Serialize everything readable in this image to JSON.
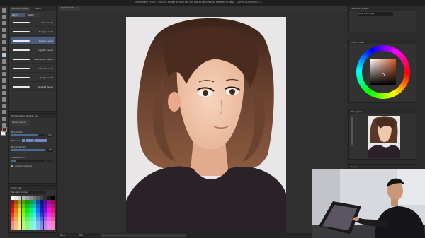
{
  "titlebar": {
    "title": "Illustration* (3500 x 5000px 300dpi 66.6%) You can use all features for another 30 days - CLIP STUDIO PAINT EX"
  },
  "document_tab": {
    "label": "Illustration*"
  },
  "brush_panel": {
    "tabs": [
      "Sub Tool [Brush]",
      "Pencil"
    ],
    "subtabs": [
      "Pencil",
      "Pastel"
    ],
    "brushes": [
      {
        "name": "Real pencil",
        "selected": false
      },
      {
        "name": "Design pencil",
        "selected": false
      },
      {
        "name": "Darker pencil",
        "selected": true
      },
      {
        "name": "Lighter pencil",
        "selected": false
      },
      {
        "name": "Mechanical pencil",
        "selected": false
      },
      {
        "name": "Colored pencil",
        "selected": false
      },
      {
        "name": "Rough pencil",
        "selected": false
      },
      {
        "name": "Spotted Pencil",
        "selected": false
      }
    ]
  },
  "tool_property": {
    "header": "Tool property [Darker pe",
    "brush_name": "Darker pencil",
    "brush_size_label": "Brush Size",
    "brush_size_value": "50.0",
    "hardness_label": "Hardness",
    "brush_density_label": "Brush density",
    "brush_density_value": "100",
    "stabilization_label": "Stabilization",
    "stabilization_value": "6",
    "adjust_by_speed_label": "Adjust by speed",
    "brush_size_level": 0.8,
    "brush_density_level": 1.0,
    "stabilization_level": 0.15
  },
  "color_set": {
    "header": "Color Set",
    "set_name": "Standard color set"
  },
  "right_panels": {
    "layer_header": "Sub Tool [Brush]",
    "layer_dropdown": "Show Brush layers",
    "color_wheel_header": "Color Wheel",
    "navigator_header": "Navigator",
    "layer_panel_header": "Layer"
  },
  "status": {
    "zoom": "66.6",
    "coords": "0.0"
  },
  "colors": {
    "accent": "#4b5d7a",
    "canvas_bg": "#e8e6e6",
    "hair": "#5a3828",
    "skin": "#f1c7ad",
    "shirt": "#2a2228"
  }
}
